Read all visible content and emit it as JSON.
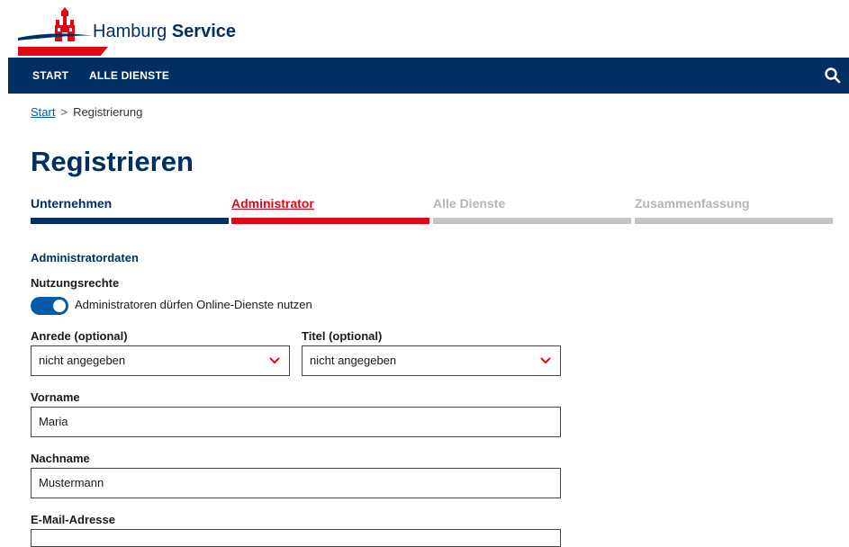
{
  "brand": {
    "name_regular": "Hamburg",
    "name_bold": "Service",
    "accent": "#e30613",
    "primary": "#003063"
  },
  "nav": {
    "items": [
      "START",
      "ALLE DIENSTE"
    ],
    "search_icon": "search-icon"
  },
  "breadcrumb": {
    "home": "Start",
    "separator": ">",
    "current": "Registrierung"
  },
  "page": {
    "title": "Registrieren"
  },
  "steps": [
    {
      "label": "Unternehmen",
      "state": "done",
      "color": "#003063",
      "bar": "#003063"
    },
    {
      "label": "Administrator",
      "state": "active",
      "color": "#e30613",
      "bar": "#e30613"
    },
    {
      "label": "Alle Dienste",
      "state": "upcoming",
      "color": "#b5b5b5",
      "bar": "#c4c4c4"
    },
    {
      "label": "Zusammenfassung",
      "state": "upcoming",
      "color": "#b5b5b5",
      "bar": "#c4c4c4"
    }
  ],
  "form": {
    "section_title": "Administratordaten",
    "usage_label": "Nutzungsrechte",
    "usage_toggle_text": "Administratoren dürfen Online-Dienste nutzen",
    "usage_toggle_on": true,
    "salutation_label": "Anrede (optional)",
    "salutation_value": "nicht angegeben",
    "title_label": "Titel (optional)",
    "title_value": "nicht angegeben",
    "firstname_label": "Vorname",
    "firstname_value": "Maria",
    "lastname_label": "Nachname",
    "lastname_value": "Mustermann",
    "email_label": "E-Mail-Adresse"
  }
}
